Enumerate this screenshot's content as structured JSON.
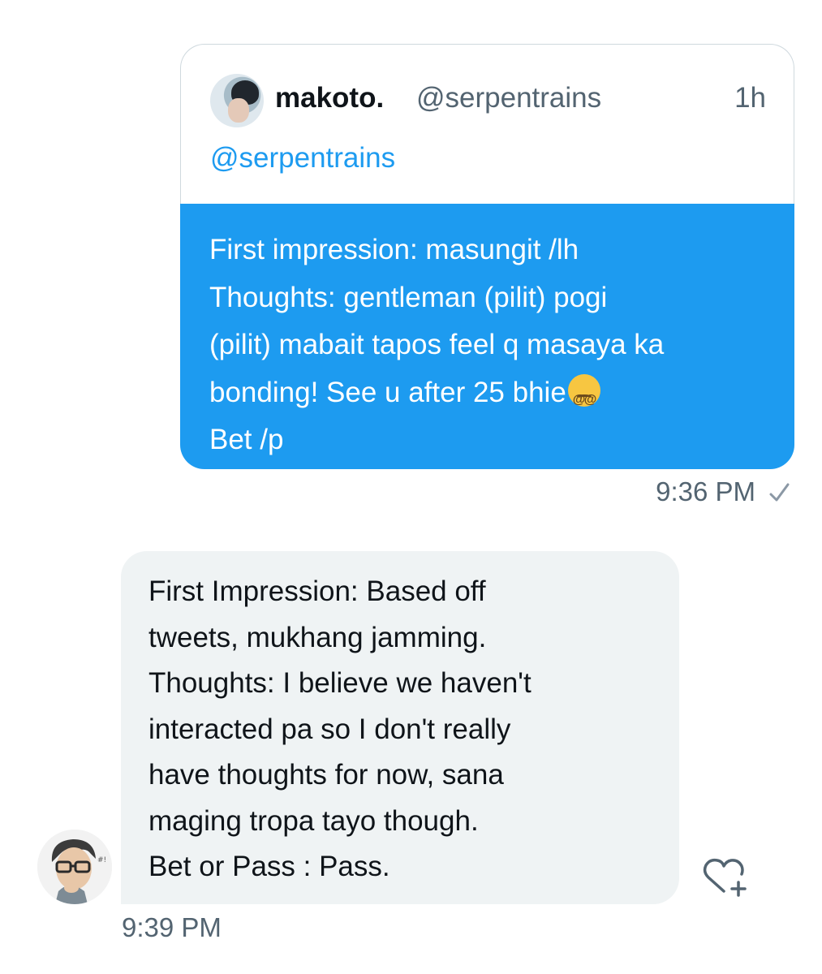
{
  "sent_message": {
    "quoted_tweet": {
      "author_name": "makoto.",
      "author_handle": "@serpentrains",
      "time_ago": "1h",
      "body_mention": "@serpentrains"
    },
    "lines": [
      "First impression: masungit /lh",
      "Thoughts: gentleman (pilit) pogi",
      "(pilit) mabait tapos feel q masaya ka",
      "bonding! See u after 25 bhie",
      "Bet  /p"
    ],
    "timestamp": "9:36 PM",
    "status": "sent-check",
    "bubble_color": "#1d9bf0"
  },
  "received_message": {
    "lines": [
      "First Impression: Based off",
      "tweets,  mukhang jamming.",
      "Thoughts: I believe we haven't",
      "interacted pa so I don't really",
      "have thoughts for now,  sana",
      "maging tropa tayo though.",
      "Bet or Pass : Pass."
    ],
    "timestamp": "9:39 PM",
    "bubble_color": "#eff3f4",
    "reaction_button_icon": "heart-plus-icon"
  },
  "colors": {
    "accent": "#1d9bf0",
    "secondary_text": "#536471",
    "primary_text": "#0f1419"
  }
}
